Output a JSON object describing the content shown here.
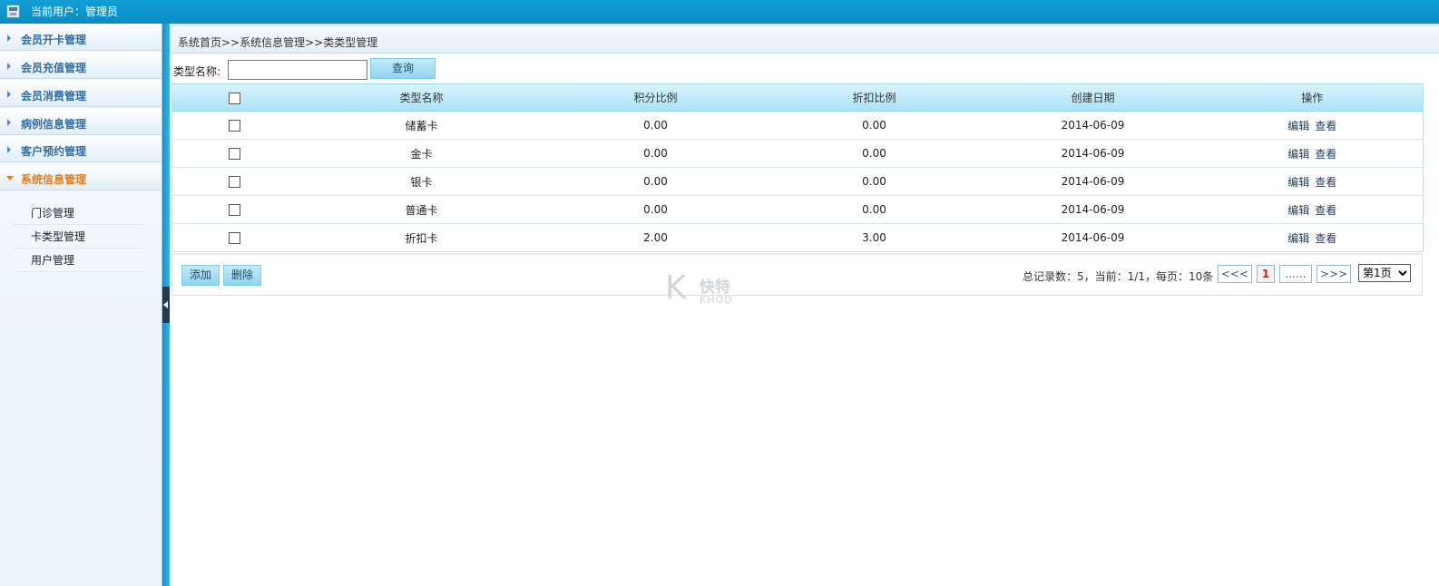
{
  "header": {
    "user_label": "当前用户：管理员"
  },
  "sidebar": {
    "items": [
      {
        "label": "会员开卡管理"
      },
      {
        "label": "会员充值管理"
      },
      {
        "label": "会员消费管理"
      },
      {
        "label": "病例信息管理"
      },
      {
        "label": "客户预约管理"
      },
      {
        "label": "系统信息管理"
      }
    ],
    "submenu": [
      {
        "label": "门诊管理"
      },
      {
        "label": "卡类型管理"
      },
      {
        "label": "用户管理"
      }
    ]
  },
  "breadcrumb": "系统首页>>系统信息管理>>类类型管理",
  "search": {
    "label": "类型名称:",
    "value": "",
    "button": "查询"
  },
  "table": {
    "columns": [
      "类型名称",
      "积分比例",
      "折扣比例",
      "创建日期",
      "操作"
    ],
    "rows": [
      {
        "name": "储蓄卡",
        "points": "0.00",
        "discount": "0.00",
        "date": "2014-06-09"
      },
      {
        "name": "金卡",
        "points": "0.00",
        "discount": "0.00",
        "date": "2014-06-09"
      },
      {
        "name": "银卡",
        "points": "0.00",
        "discount": "0.00",
        "date": "2014-06-09"
      },
      {
        "name": "普通卡",
        "points": "0.00",
        "discount": "0.00",
        "date": "2014-06-09"
      },
      {
        "name": "折扣卡",
        "points": "2.00",
        "discount": "3.00",
        "date": "2014-06-09"
      }
    ],
    "actions": {
      "edit": "编辑",
      "view": "查看"
    }
  },
  "footer": {
    "add": "添加",
    "delete": "删除",
    "page_info": "总记录数：5，当前：1/1，每页：10条",
    "first": "<<<",
    "current": "1",
    "more": "......",
    "last": ">>>",
    "select_value": "第1页"
  },
  "watermark": {
    "line1": "快特",
    "line2": "KHOD"
  },
  "colors": {
    "accent": "#0a9bd3",
    "active_menu": "#e57b16",
    "menu_text": "#2f6ea6"
  }
}
